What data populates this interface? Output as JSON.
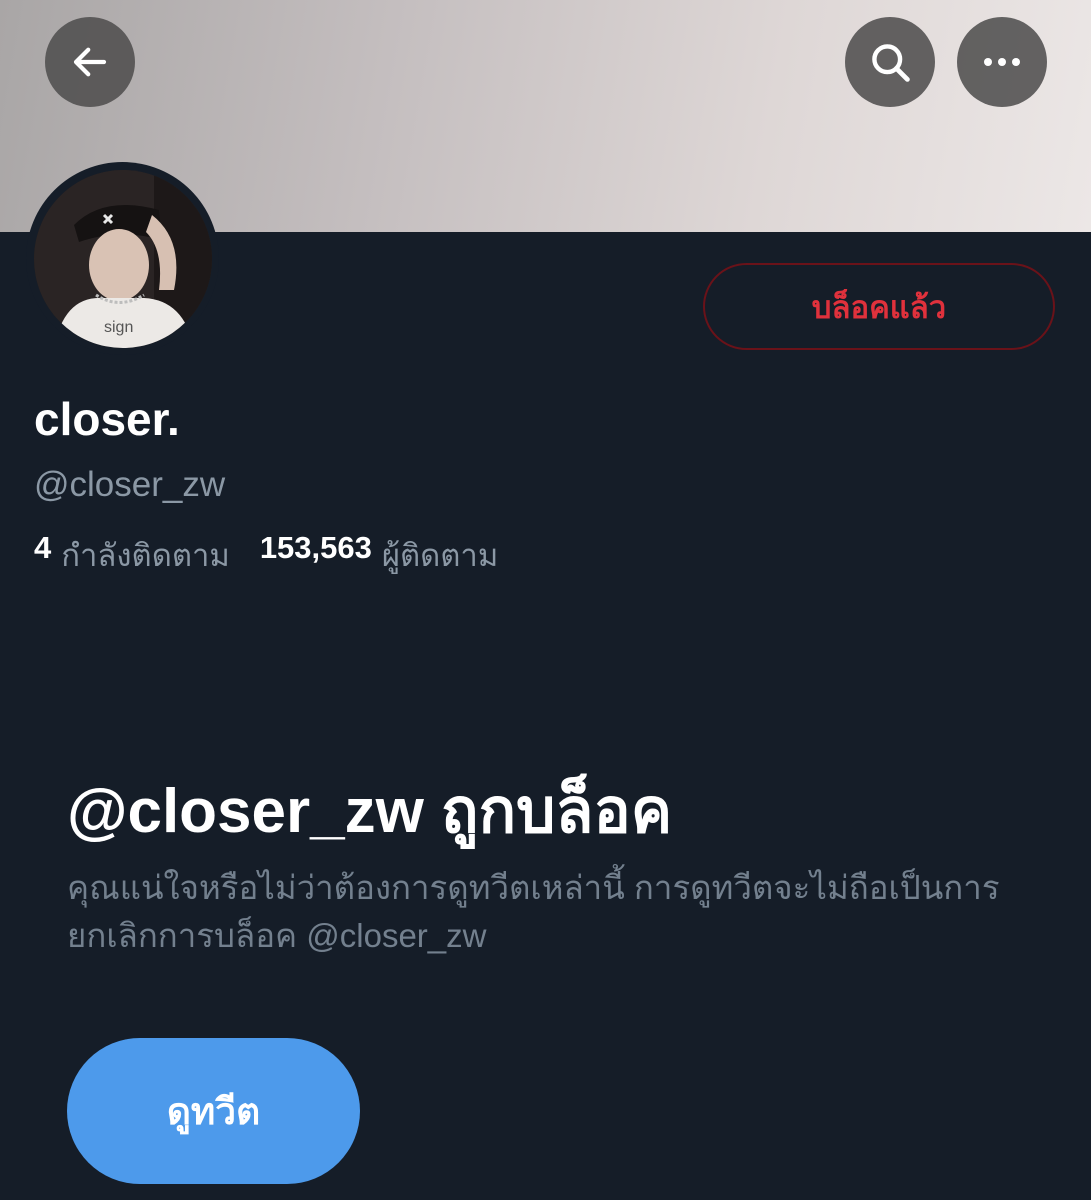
{
  "header": {
    "back_icon": "arrow-left-icon",
    "search_icon": "search-icon",
    "more_icon": "more-horizontal-icon"
  },
  "profile": {
    "blocked_button_label": "บล็อคแล้ว",
    "display_name": "closer.",
    "handle": "@closer_zw",
    "following_count": "4",
    "following_label": "กำลังติดตาม",
    "followers_count": "153,563",
    "followers_label": "ผู้ติดตาม"
  },
  "blocked_notice": {
    "title": "@closer_zw ถูกบล็อค",
    "description": "คุณแน่ใจหรือไม่ว่าต้องการดูทวีตเหล่านี้ การดูทวีตจะไม่ถือเป็นการยกเลิกการบล็อค @closer_zw",
    "view_button_label": "ดูทวีต"
  },
  "colors": {
    "background": "#151d28",
    "blocked_red": "#e0313c",
    "blocked_border": "#6a1219",
    "accent_blue": "#4d9aeb",
    "muted_text": "#8b98a5"
  }
}
